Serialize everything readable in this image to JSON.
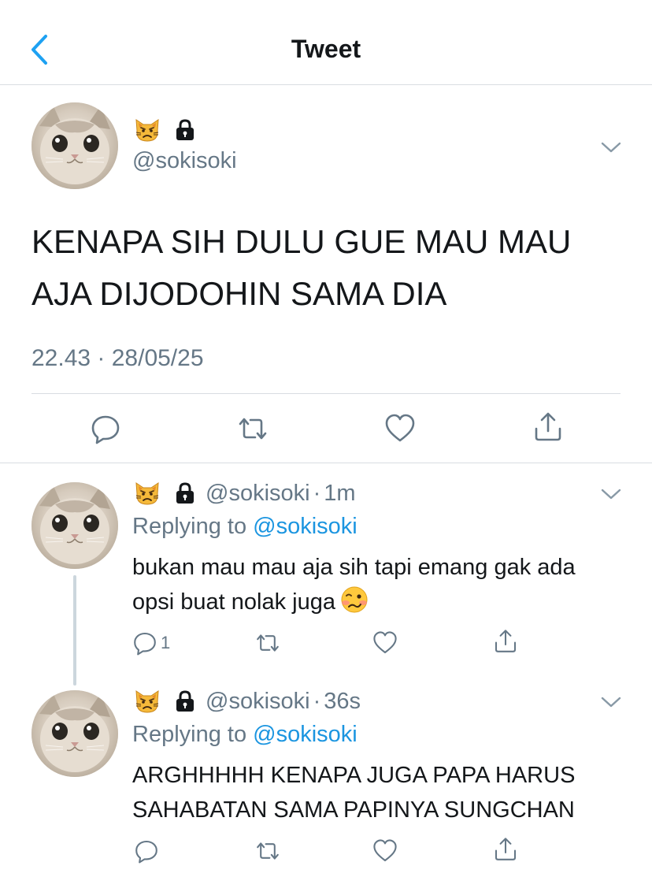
{
  "nav": {
    "title": "Tweet"
  },
  "main_tweet": {
    "handle": "@sokisoki",
    "text": "KENAPA SIH DULU GUE MAU MAU AJA DIJODOHIN SAMA DIA",
    "timestamp": "22.43 · 28/05/25"
  },
  "replies": [
    {
      "handle": "@sokisoki",
      "separator": "·",
      "time": "1m",
      "replying_prefix": "Replying to",
      "replying_to": "@sokisoki",
      "text_line1": "bukan mau mau aja sih tapi emang gak ada",
      "text_line2": "opsi buat nolak juga",
      "reply_count": "1"
    },
    {
      "handle": "@sokisoki",
      "separator": "·",
      "time": "36s",
      "replying_prefix": "Replying to",
      "replying_to": "@sokisoki",
      "text_line1": "ARGHHHHH KENAPA JUGA PAPA HARUS",
      "text_line2": "SAHABATAN SAMA PAPINYA SUNGCHAN"
    }
  ],
  "colors": {
    "accent": "#1da1f2",
    "link": "#1b95e0",
    "secondary_text": "#657786",
    "divider": "#d9dde1"
  },
  "icons": [
    "back-chevron-icon",
    "pouting-cat-emoji",
    "lock-icon",
    "chevron-down-icon",
    "reply-icon",
    "retweet-icon",
    "like-icon",
    "share-icon",
    "woozy-face-emoji",
    "avatar-cat-photo"
  ]
}
